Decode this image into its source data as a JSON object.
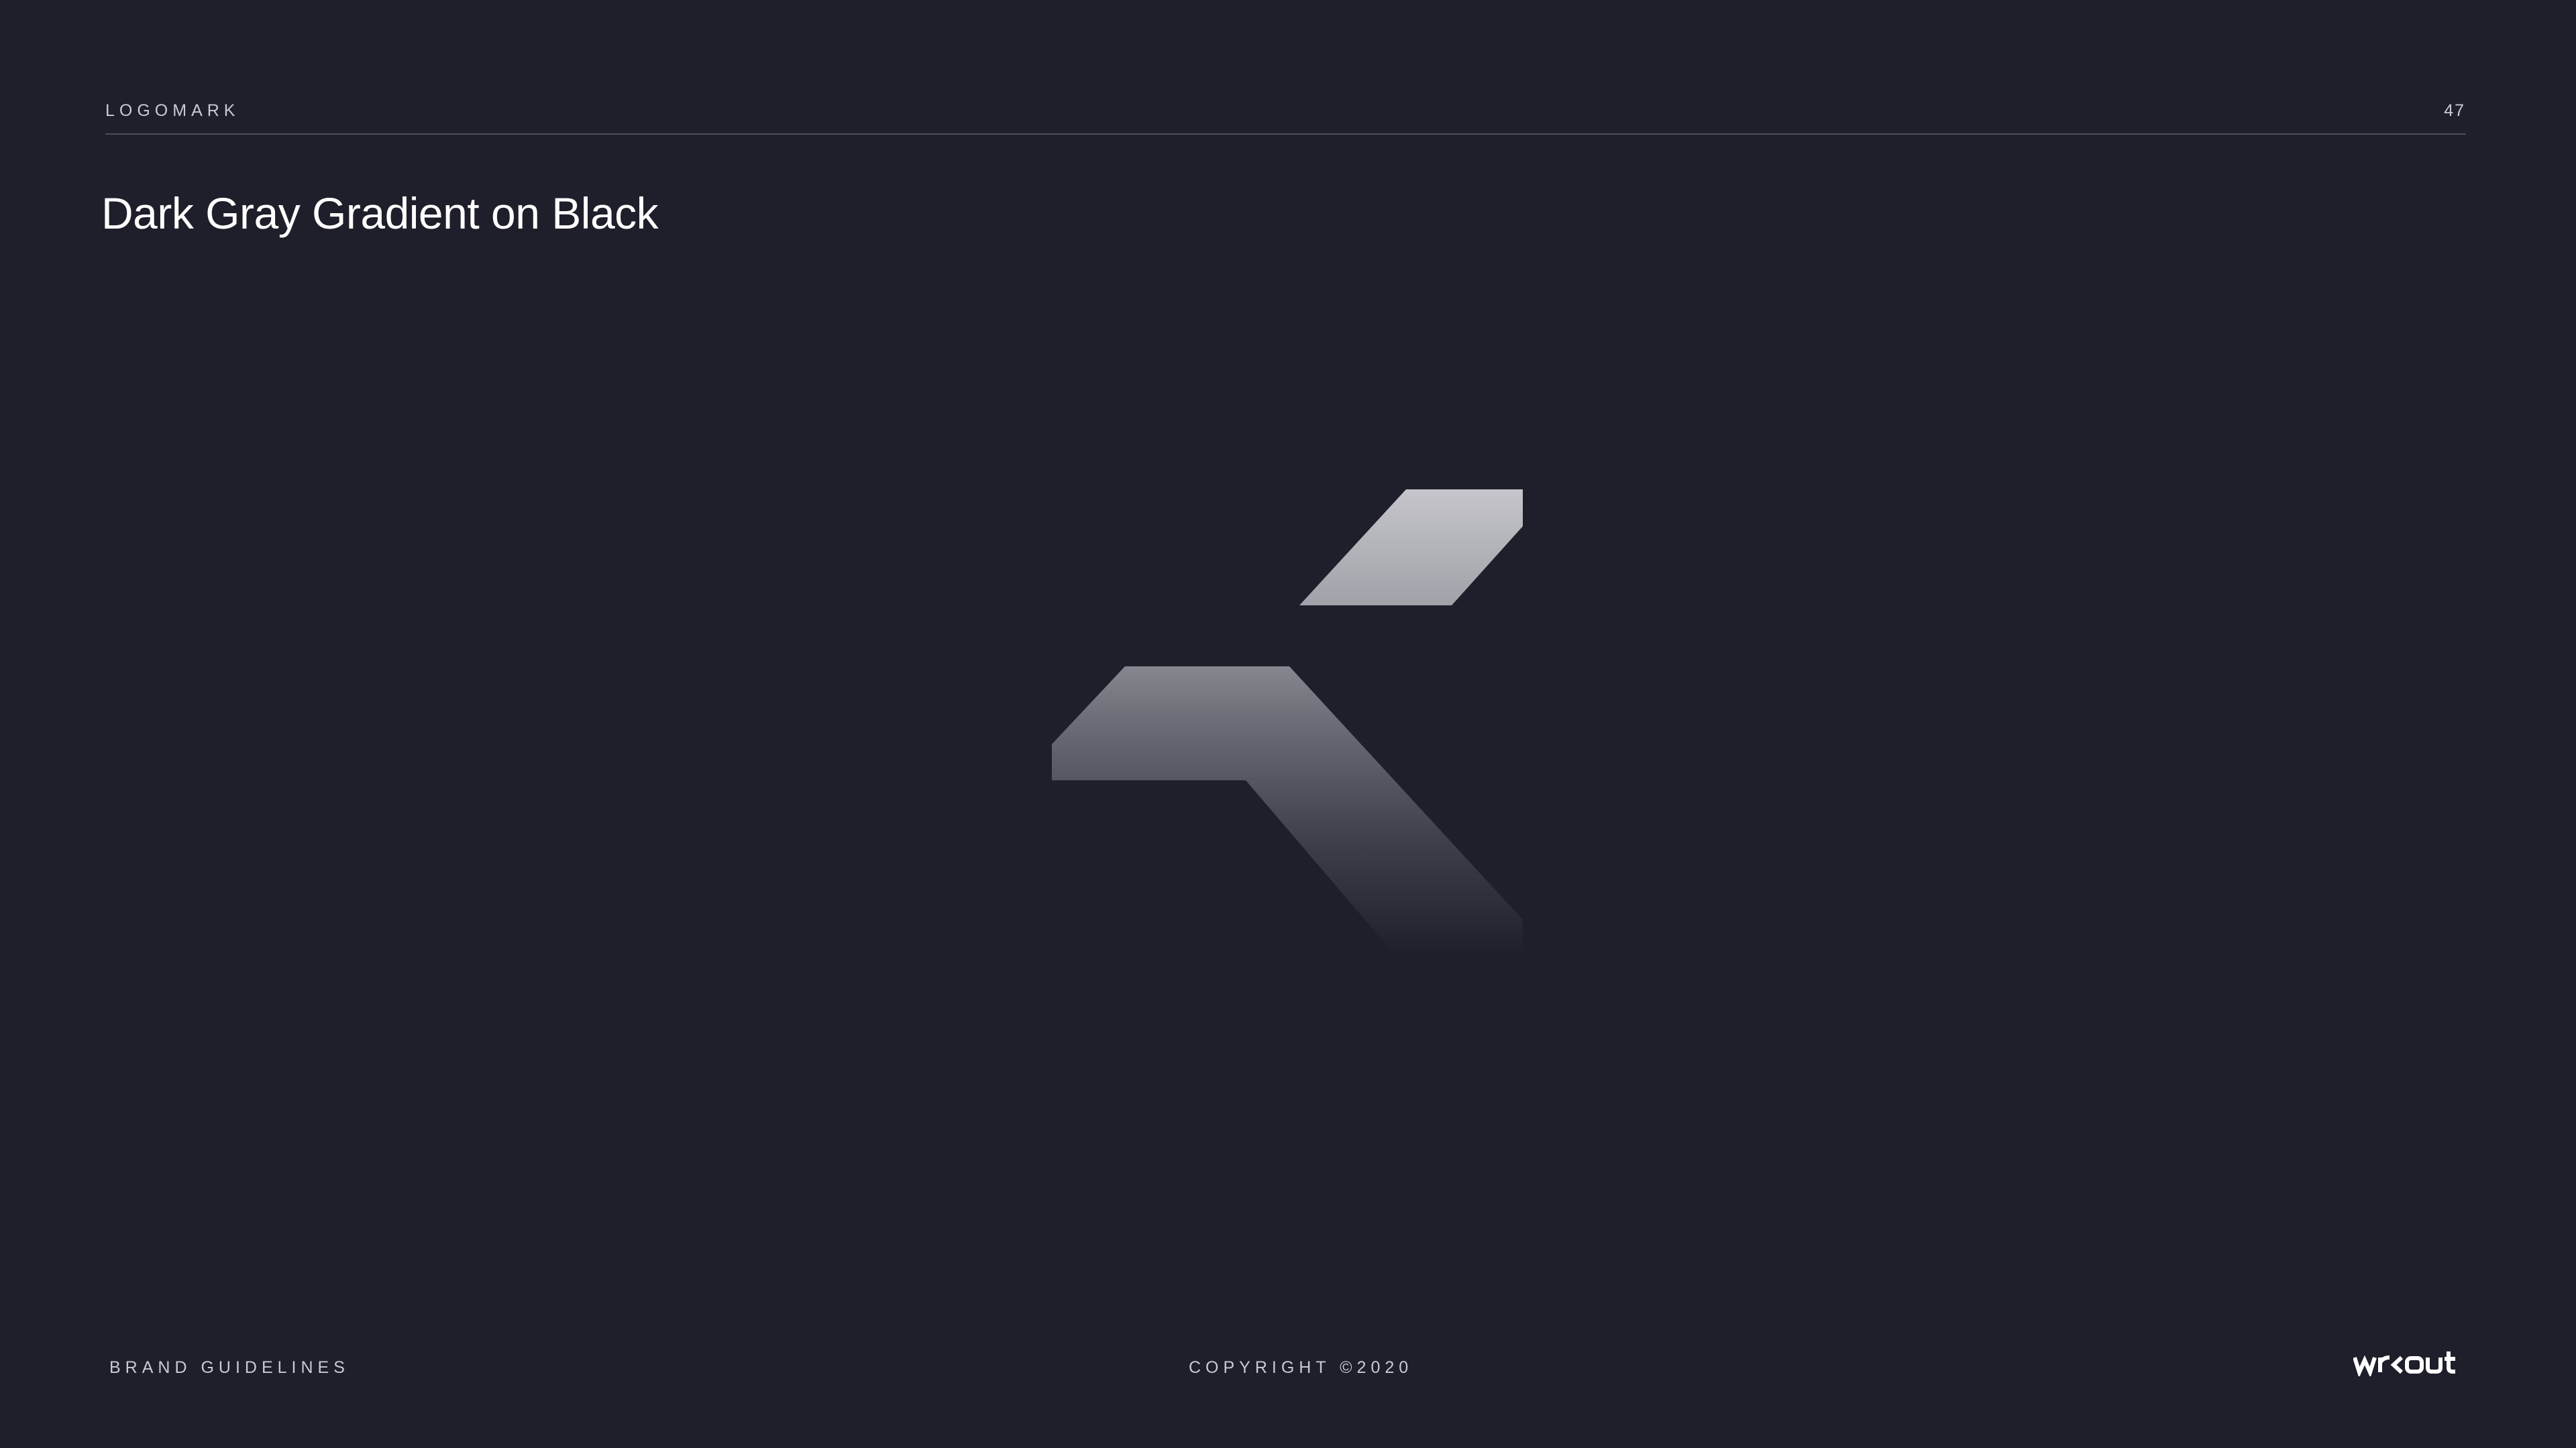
{
  "header": {
    "section_label": "LOGOMARK",
    "page_number": "47"
  },
  "title": "Dark Gray Gradient on Black",
  "logomark": {
    "icon": "wrkout-logomark-icon",
    "gradient_top": "#c6c6cc",
    "gradient_bottom": "#1e1f2a"
  },
  "footer": {
    "left_label": "BRAND GUIDELINES",
    "copyright": "COPYRIGHT ©2020",
    "brand_wordmark": "wrkout"
  },
  "colors": {
    "background": "#1e1f2a",
    "text_muted": "#c9cad2",
    "rule": "#4a4c58"
  }
}
